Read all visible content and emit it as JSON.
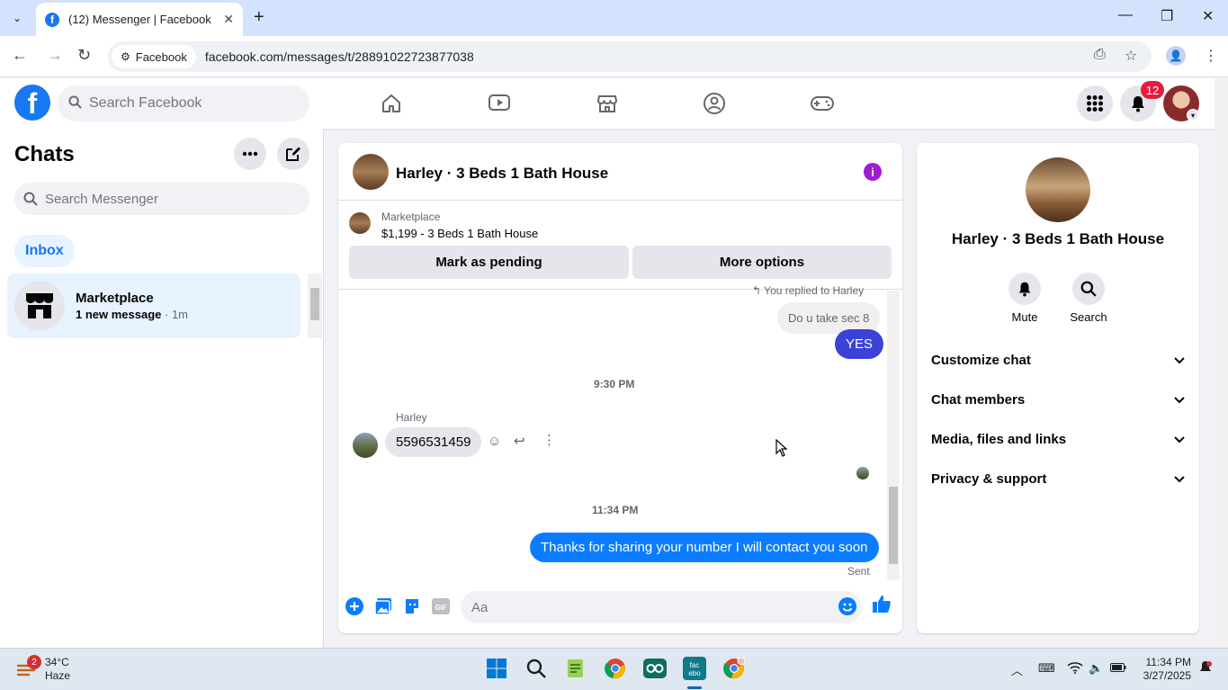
{
  "browser": {
    "tab_title": "(12) Messenger | Facebook",
    "site_chip": "Facebook",
    "url": "facebook.com/messages/t/28891022723877038"
  },
  "fb": {
    "search_placeholder": "Search Facebook",
    "notifications_count": "12"
  },
  "left": {
    "title": "Chats",
    "search_placeholder": "Search Messenger",
    "inbox_label": "Inbox",
    "chats": [
      {
        "name": "Marketplace",
        "preview_bold": "1 new message",
        "preview_time": " · 1m"
      }
    ]
  },
  "conversation": {
    "name": "Harley · 3 Beds 1 Bath House",
    "marketplace_label": "Marketplace",
    "listing": "$1,199 - 3 Beds 1 Bath House",
    "mark_pending": "Mark as pending",
    "more_options": "More options",
    "reply_note": "You replied to Harley",
    "quoted_reply": "Do u take sec 8",
    "my_reply": "YES",
    "time1": "9:30 PM",
    "sender": "Harley",
    "their_message": "5596531459",
    "time2": "11:34 PM",
    "sent_message": "Thanks for sharing your number I will contact you soon",
    "status": "Sent",
    "composer_placeholder": "Aa"
  },
  "right": {
    "name": "Harley · 3 Beds 1 Bath House",
    "mute": "Mute",
    "search": "Search",
    "sections": [
      "Customize chat",
      "Chat members",
      "Media, files and links",
      "Privacy & support"
    ]
  },
  "taskbar": {
    "weather_temp": "34°C",
    "weather_desc": "Haze",
    "weather_badge": "2",
    "time": "11:34 PM",
    "date": "3/27/2025"
  },
  "colors": {
    "fb_blue": "#1877f2",
    "messenger_blue": "#0a7cff",
    "reply_bubble": "#3c42d8",
    "info_purple": "#a21cd6",
    "badge_red": "#e41e3f"
  }
}
